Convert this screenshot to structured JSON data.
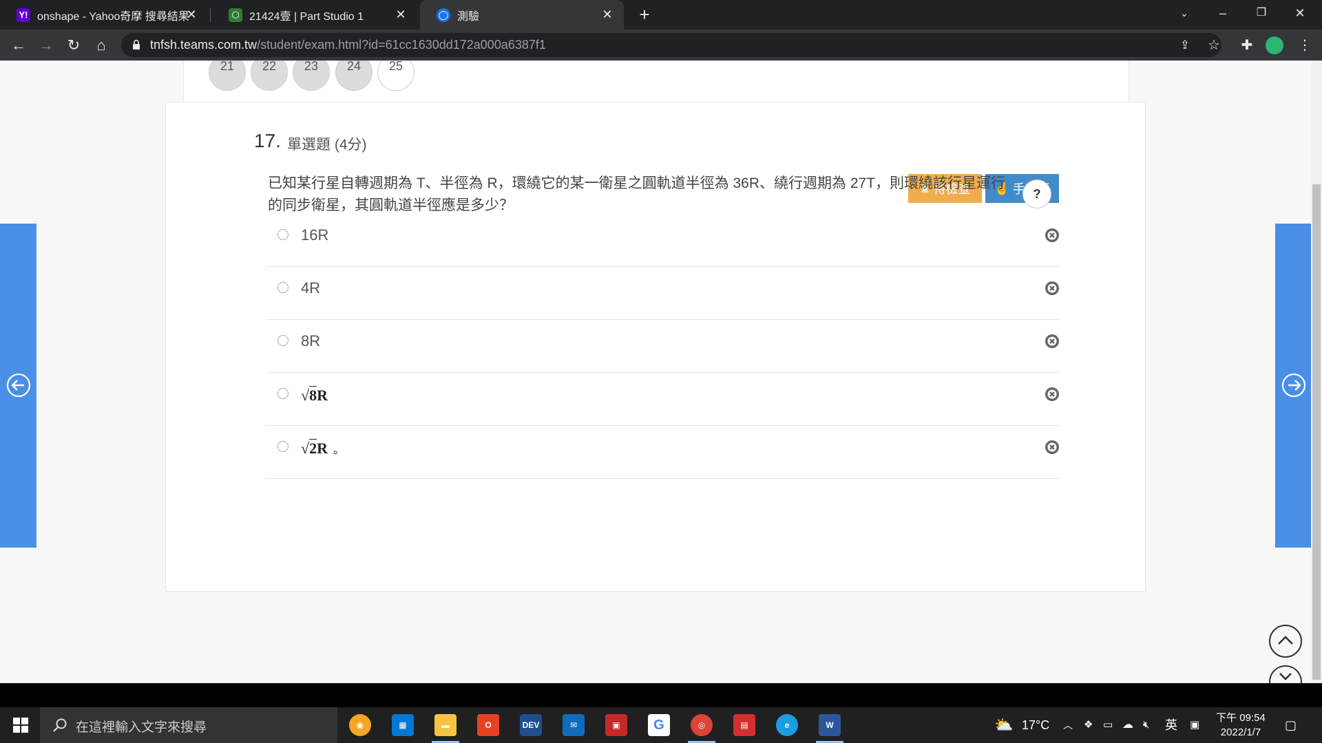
{
  "browser": {
    "tabs": [
      {
        "title": "onshape - Yahoo奇摩 搜尋結果",
        "icon": "yahoo-icon",
        "color": "#6001d2"
      },
      {
        "title": "21424壹 | Part Studio 1",
        "icon": "onshape-icon",
        "color": "#4caf50"
      },
      {
        "title": "測驗",
        "icon": "teams-icon",
        "color": "#1a73e8"
      }
    ],
    "url_host": "tnfsh.teams.com.tw",
    "url_path": "/student/exam.html?id=61cc1630dd172a000a6387f1"
  },
  "question_nav": [
    "21",
    "22",
    "23",
    "24",
    "25"
  ],
  "question": {
    "number": "17.",
    "type": "單選題 (4分)",
    "pending_label": "待檢查",
    "handwrite_label": "手寫板",
    "text": "已知某行星自轉週期為 T、半徑為 R，環繞它的某一衛星之圓軌道半徑為 36R、繞行週期為 27T，則環繞該行星運行的同步衛星，其圓軌道半徑應是多少？",
    "help_label": "?",
    "options": [
      {
        "label": "16R"
      },
      {
        "label": "4R"
      },
      {
        "label": "8R"
      },
      {
        "radicand": "8",
        "suffix": "R"
      },
      {
        "radicand": "2",
        "suffix": "R",
        "trail": "。"
      }
    ]
  },
  "taskbar": {
    "search_placeholder": "在這裡輸入文字來搜尋",
    "temperature": "17°C",
    "ime": "英",
    "time": "下午 09:54",
    "date": "2022/1/7"
  },
  "colors": {
    "accent": "#4a8fe7",
    "pending": "#f0ad4e",
    "handwrite": "#428bca"
  }
}
